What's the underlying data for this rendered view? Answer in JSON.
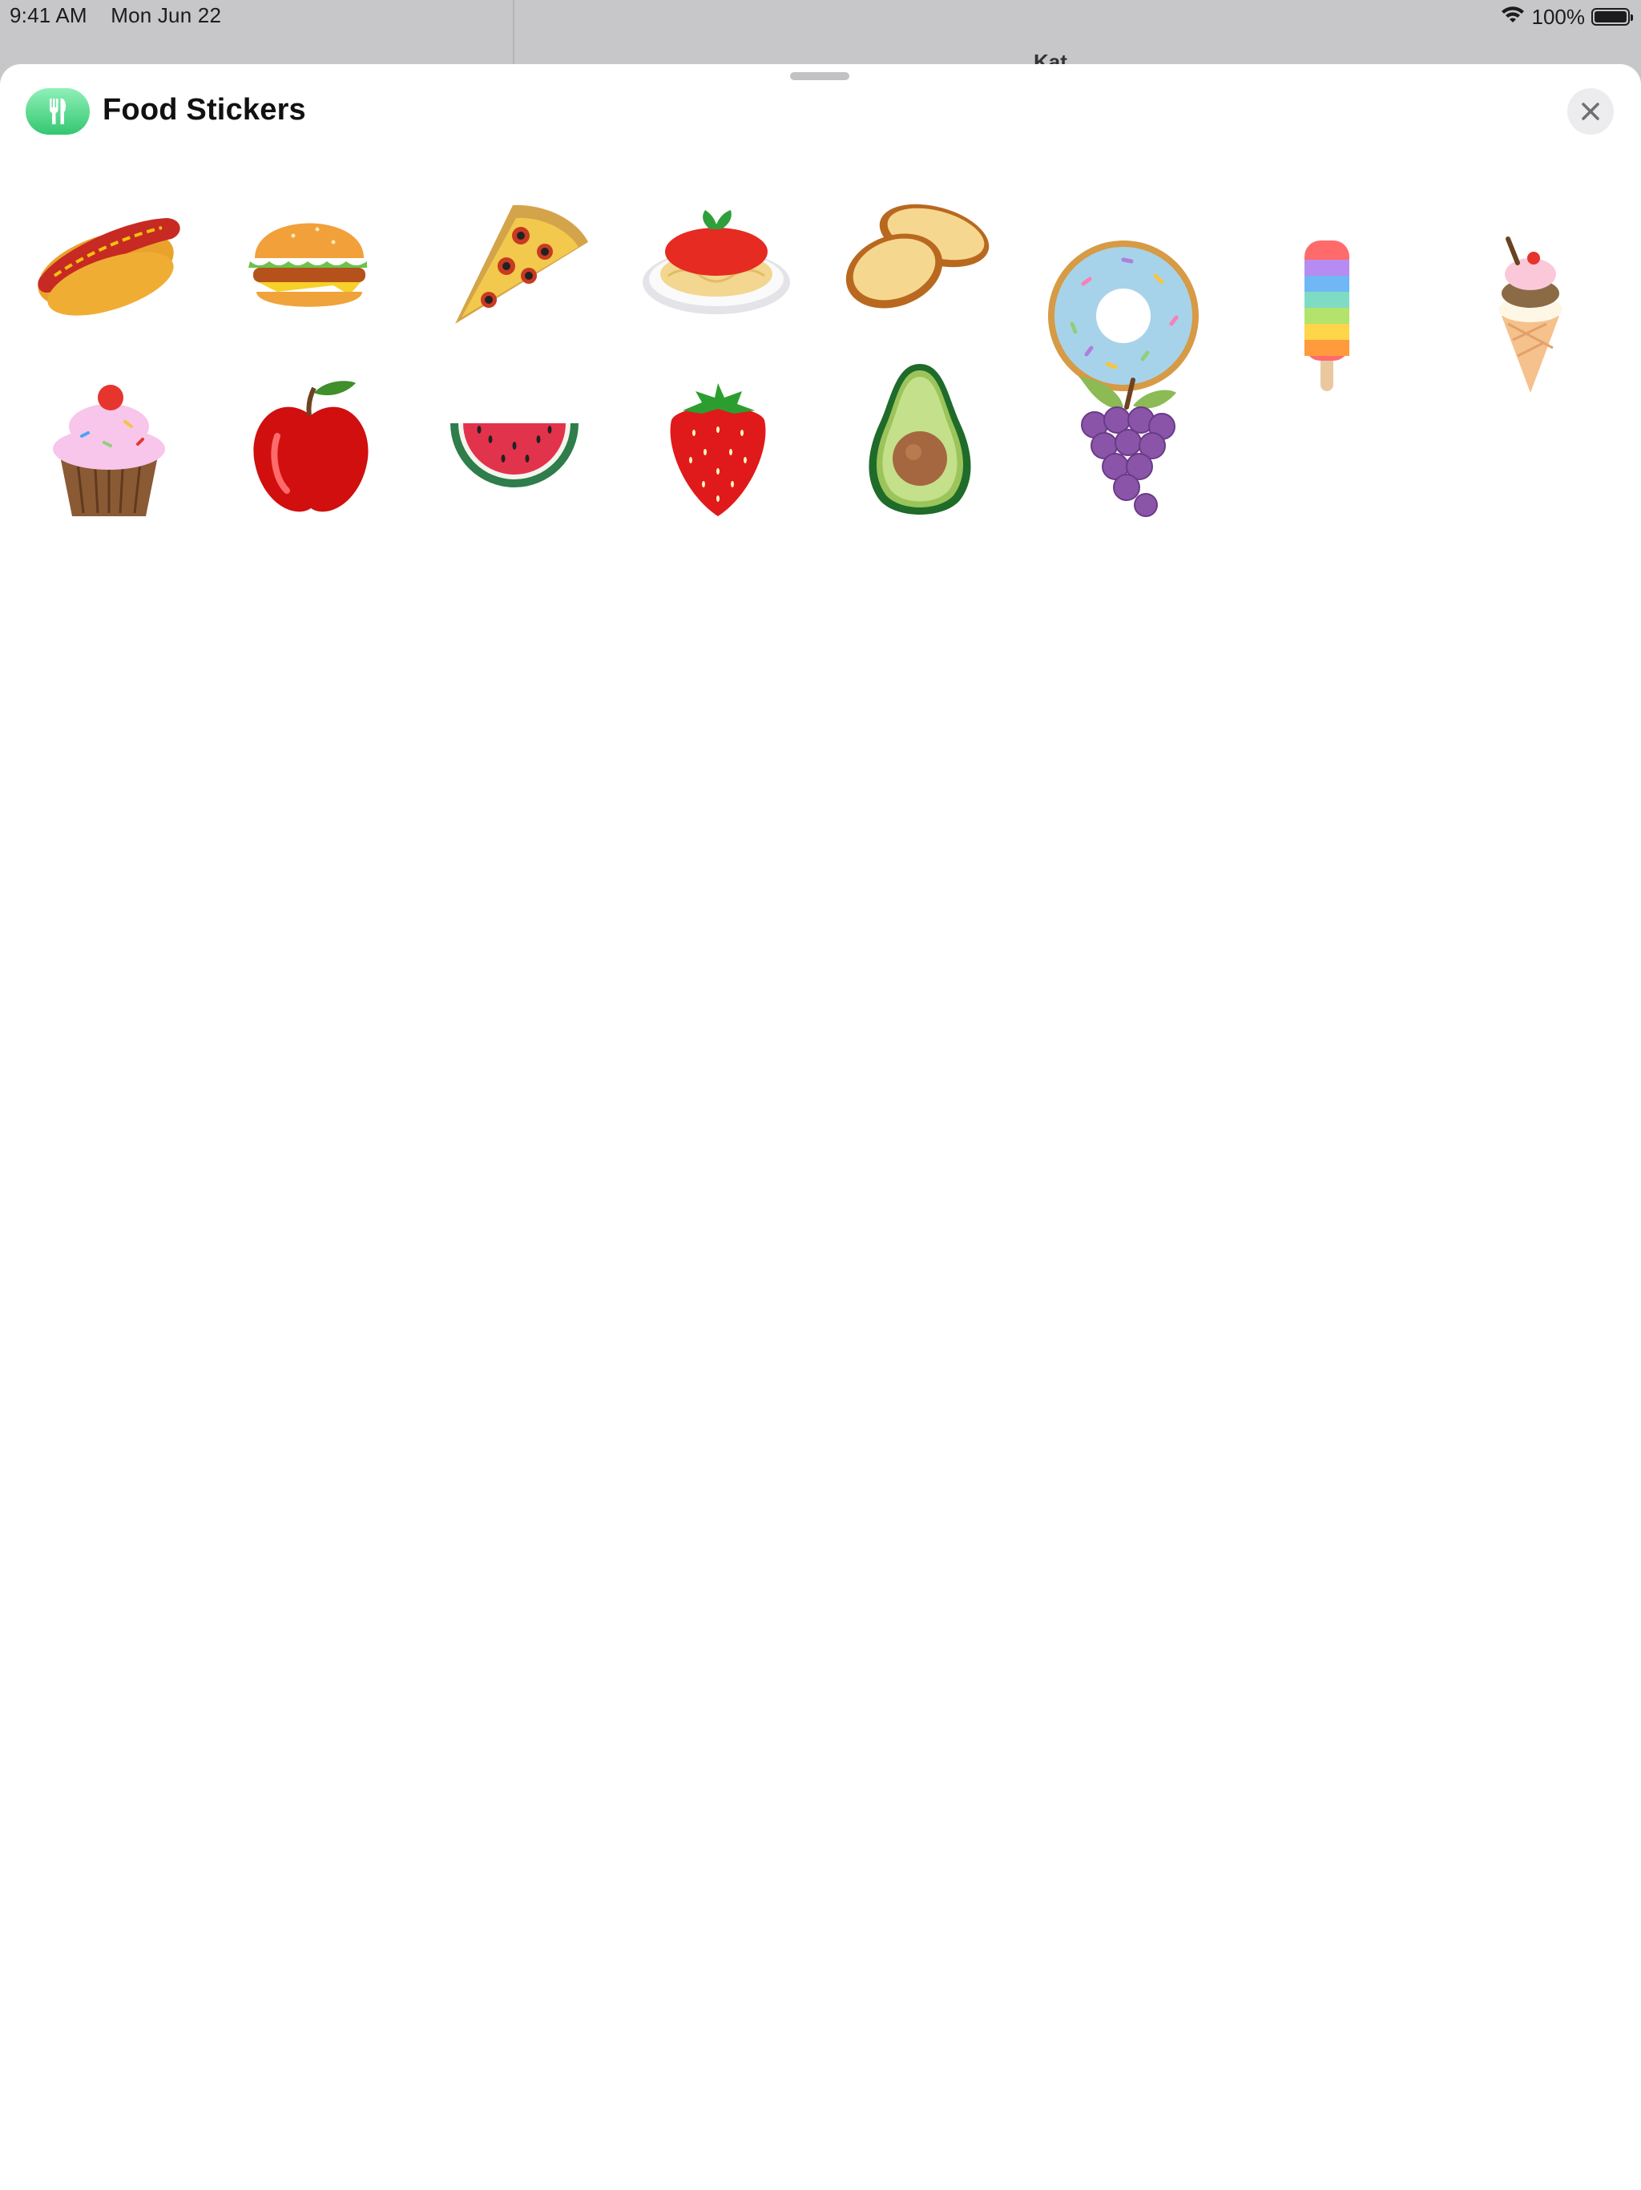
{
  "status_bar": {
    "time": "9:41 AM",
    "date": "Mon Jun 22",
    "battery_percent_text": "100%",
    "battery_level": 1.0,
    "background_app_title": "Kat"
  },
  "sheet": {
    "app_icon": "fork-knife-icon",
    "title": "Food Stickers",
    "close_icon": "close-x-icon",
    "accent_color": "#34c771"
  },
  "stickers": [
    {
      "name": "hot-dog"
    },
    {
      "name": "hamburger"
    },
    {
      "name": "pizza-slice"
    },
    {
      "name": "spaghetti"
    },
    {
      "name": "garlic-bread"
    },
    {
      "name": "donut"
    },
    {
      "name": "rainbow-popsicle"
    },
    {
      "name": "ice-cream-cone"
    },
    {
      "name": "cupcake"
    },
    {
      "name": "red-apple"
    },
    {
      "name": "watermelon-slice"
    },
    {
      "name": "strawberry"
    },
    {
      "name": "avocado"
    },
    {
      "name": "grapes"
    }
  ]
}
